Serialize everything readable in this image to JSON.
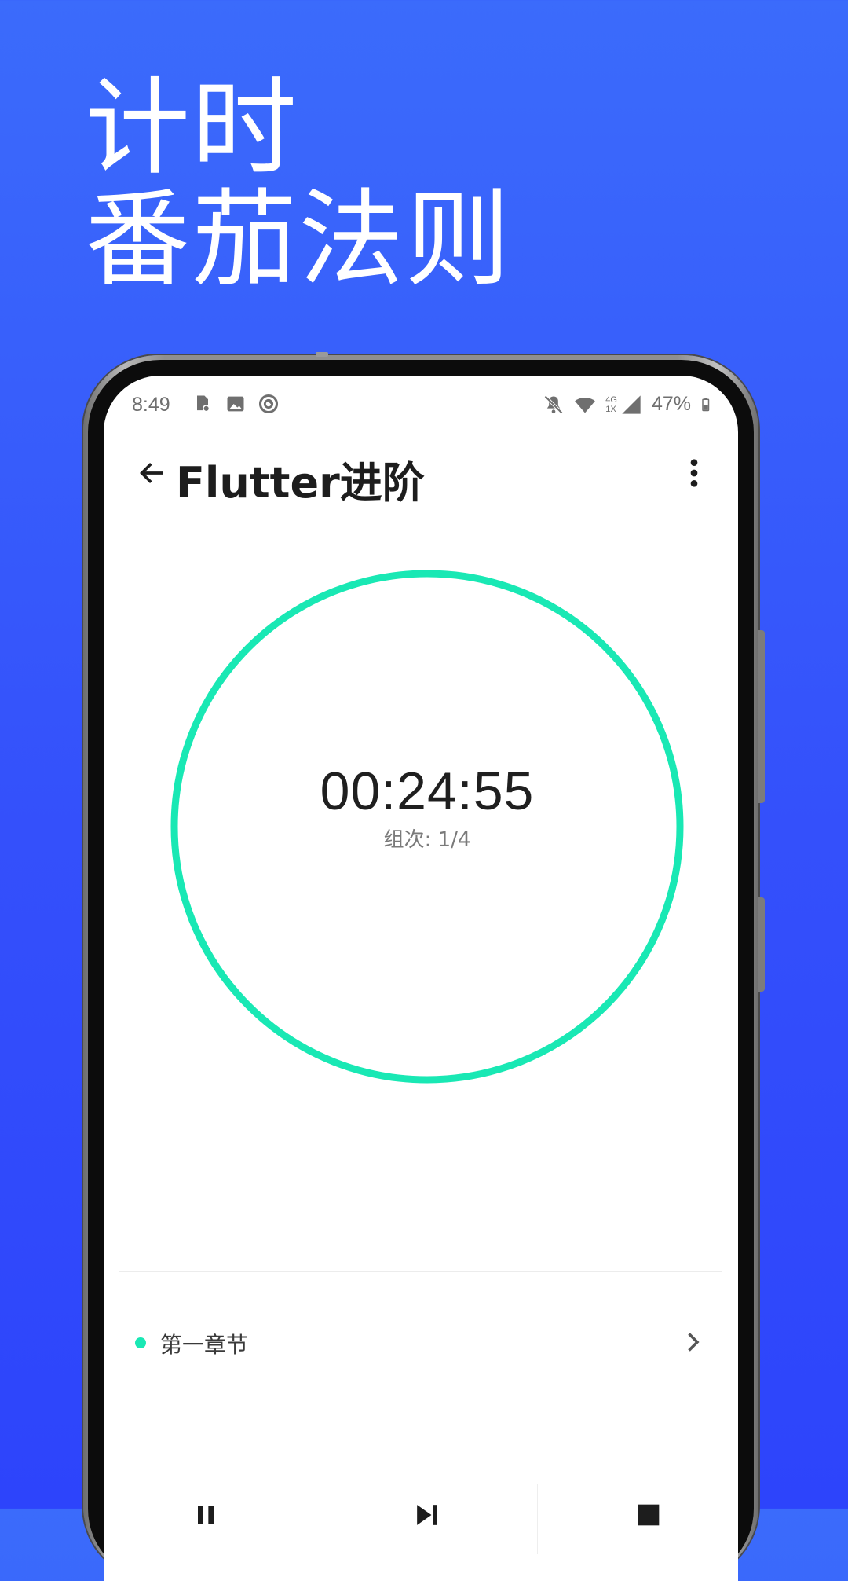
{
  "headline": {
    "line1": "计时",
    "line2": "番茄法则"
  },
  "status_bar": {
    "time": "8:49",
    "left_icons": [
      "notification-icon",
      "image-icon",
      "sync-icon"
    ],
    "right_icons": [
      "mute-icon",
      "wifi-icon",
      "signal-icon"
    ],
    "network_label_top": "4G",
    "network_label_bottom": "1X",
    "battery": "47%"
  },
  "toolbar": {
    "title": "Flutter进阶",
    "back_icon": "arrow-left-icon",
    "more_icon": "more-vertical-icon"
  },
  "timer": {
    "time": "00:24:55",
    "round_label": "组次: 1/4",
    "progress": 1.0,
    "ring_color": "#19e8b4"
  },
  "task": {
    "label": "第一章节",
    "dot_color": "#19e8b4"
  },
  "controls": {
    "pause_icon": "pause-icon",
    "next_icon": "skip-next-icon",
    "stop_icon": "stop-icon"
  },
  "colors": {
    "background_top": "#3b6bfb",
    "background_bottom": "#2d44fb",
    "accent": "#19e8b4"
  }
}
